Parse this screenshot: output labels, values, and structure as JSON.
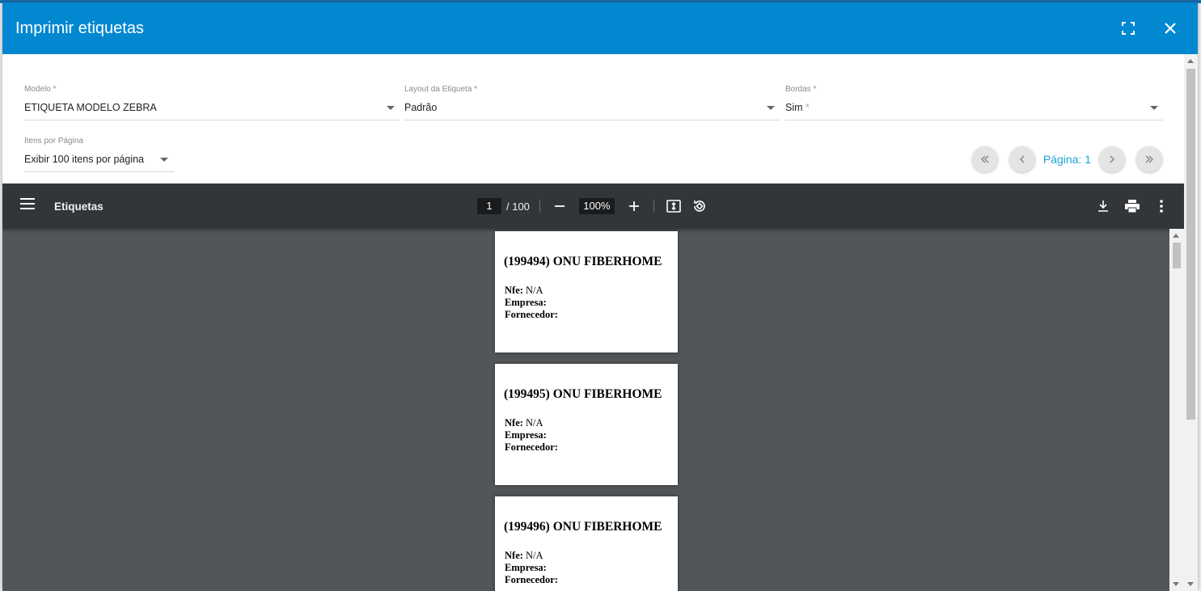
{
  "dialog": {
    "title": "Imprimir etiquetas"
  },
  "form": {
    "modelo": {
      "label": "Modelo *",
      "value": "ETIQUETA MODELO ZEBRA"
    },
    "layout": {
      "label": "Layout da Etiqueta *",
      "value": "Padrão"
    },
    "bordas": {
      "label": "Bordas *",
      "value": "Sim",
      "value_suffix": "*"
    },
    "itens": {
      "label": "Itens por Página",
      "value": "Exibir 100 itens por página"
    }
  },
  "pager": {
    "label": "Página: 1"
  },
  "viewer": {
    "title": "Etiquetas",
    "page_current": "1",
    "page_total": "/ 100",
    "zoom": "100%"
  },
  "labels": [
    {
      "title": "(199494) ONU FIBERHOME",
      "nfe_label": "Nfe:",
      "nfe_value": " N/A",
      "empresa_label": "Empresa:",
      "fornecedor_label": "Fornecedor:"
    },
    {
      "title": "(199495) ONU FIBERHOME",
      "nfe_label": "Nfe:",
      "nfe_value": " N/A",
      "empresa_label": "Empresa:",
      "fornecedor_label": "Fornecedor:"
    },
    {
      "title": "(199496) ONU FIBERHOME",
      "nfe_label": "Nfe:",
      "nfe_value": " N/A",
      "empresa_label": "Empresa:",
      "fornecedor_label": "Fornecedor:"
    }
  ],
  "colors": {
    "header": "#0288d1",
    "toolbar": "#323639",
    "viewer_bg": "#525659",
    "pager_text": "#1ca4d8"
  }
}
